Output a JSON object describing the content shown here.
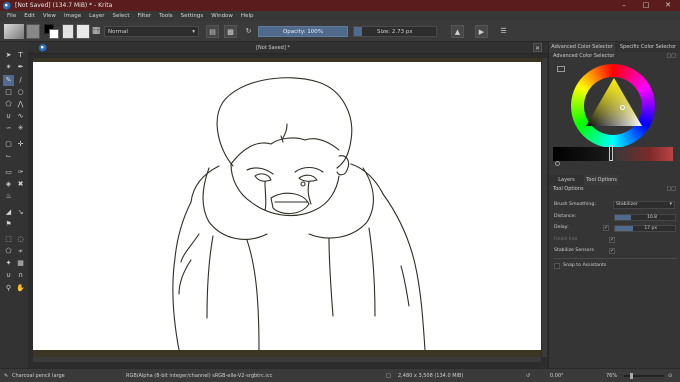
{
  "window": {
    "title": "[Not Saved] (134.7 MiB) * - Krita",
    "minimize_icon": "minimize-icon",
    "maximize_icon": "maximize-icon",
    "close_icon": "close-icon"
  },
  "menu": [
    "File",
    "Edit",
    "View",
    "Image",
    "Layer",
    "Select",
    "Filter",
    "Tools",
    "Settings",
    "Window",
    "Help"
  ],
  "toolbar": {
    "blend_mode": "Normal",
    "opacity": "Opacity: 100%",
    "size": "Size: 2.73 px"
  },
  "canvas": {
    "tab_label": "[Not Saved] *"
  },
  "dockers": {
    "tabs": [
      "Advanced Color Selector",
      "Specific Color Selector"
    ],
    "color_selector_title": "Advanced Color Selector",
    "layers_tabs": [
      "Layers",
      "Tool Options"
    ],
    "tool_options_title": "Tool Options",
    "brush_smoothing_label": "Brush Smoothing:",
    "brush_smoothing_value": "Stabilizer",
    "distance_label": "Distance:",
    "distance_value": "10.8",
    "delay_label": "Delay:",
    "delay_value": "17 px",
    "finish_line_label": "Finish line",
    "stabilize_sensors_label": "Stabilize Sensors",
    "snap_label": "Snap to Assistants"
  },
  "status": {
    "brush": "Charcoal pencil large",
    "color_space": "RGB/Alpha (8-bit integer/channel)  sRGB-elle-V2-srgbtrc.icc",
    "dimensions": "2,480 x 3,508 (134.0 MiB)",
    "rotation": "0.00°",
    "zoom": "76%"
  },
  "colors": {
    "titlebar": "#5a1c1c",
    "accent": "#4f6a8c",
    "background": "#313131"
  }
}
